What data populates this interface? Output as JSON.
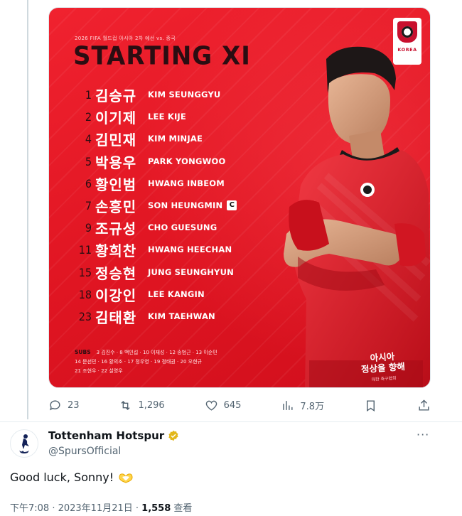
{
  "card": {
    "subtitle": "2026 FIFA 월드컵 아시아 2차 예선 vs. 중국",
    "headline": "STARTING XI",
    "badge_label": "KOREA",
    "players": [
      {
        "num": "1",
        "kor": "김승규",
        "eng": "KIM SEUNGGYU",
        "captain": false
      },
      {
        "num": "2",
        "kor": "이기제",
        "eng": "LEE KIJE",
        "captain": false
      },
      {
        "num": "4",
        "kor": "김민재",
        "eng": "KIM MINJAE",
        "captain": false
      },
      {
        "num": "5",
        "kor": "박용우",
        "eng": "PARK YONGWOO",
        "captain": false
      },
      {
        "num": "6",
        "kor": "황인범",
        "eng": "HWANG INBEOM",
        "captain": false
      },
      {
        "num": "7",
        "kor": "손흥민",
        "eng": "SON HEUNGMIN",
        "captain": true
      },
      {
        "num": "9",
        "kor": "조규성",
        "eng": "CHO GUESUNG",
        "captain": false
      },
      {
        "num": "11",
        "kor": "황희찬",
        "eng": "HWANG HEECHAN",
        "captain": false
      },
      {
        "num": "15",
        "kor": "정승현",
        "eng": "JUNG SEUNGHYUN",
        "captain": false
      },
      {
        "num": "18",
        "kor": "이강인",
        "eng": "LEE KANGIN",
        "captain": false
      },
      {
        "num": "23",
        "kor": "김태환",
        "eng": "KIM TAEHWAN",
        "captain": false
      }
    ],
    "captain_mark": "C",
    "subs_label": "SUBS",
    "subs_lines": [
      "3 김진수 · 8 백인섭 · 10 이재성 · 12 송범근 · 13 이순민",
      "14 문선민 · 16 황의조 · 17 정우영 · 19 정태권 · 20 오현규",
      "21 조현우 · 22 설영우"
    ],
    "slogan_line1": "아시아",
    "slogan_line2": "정상을 향해",
    "slogan_small": "대한 축구협회"
  },
  "actions": {
    "replies": "23",
    "retweets": "1,296",
    "likes": "645",
    "views": "7.8万"
  },
  "reply": {
    "display_name": "Tottenham Hotspur",
    "handle": "@SpursOfficial",
    "more": "···",
    "text": "Good luck, Sonny!",
    "time": "下午7:08 · 2023年11月21日 · ",
    "views_count": "1,558",
    "views_label": " 查看"
  },
  "colors": {
    "card_red": "#e01522",
    "headline_dark": "#2b0d12",
    "verified_gold": "#e2b719",
    "muted": "#536471"
  },
  "icons": [
    "reply-icon",
    "retweet-icon",
    "like-icon",
    "views-icon",
    "bookmark-icon",
    "share-icon",
    "verified-icon",
    "heart-hands-icon",
    "spurs-logo-icon",
    "korea-crest-icon"
  ]
}
